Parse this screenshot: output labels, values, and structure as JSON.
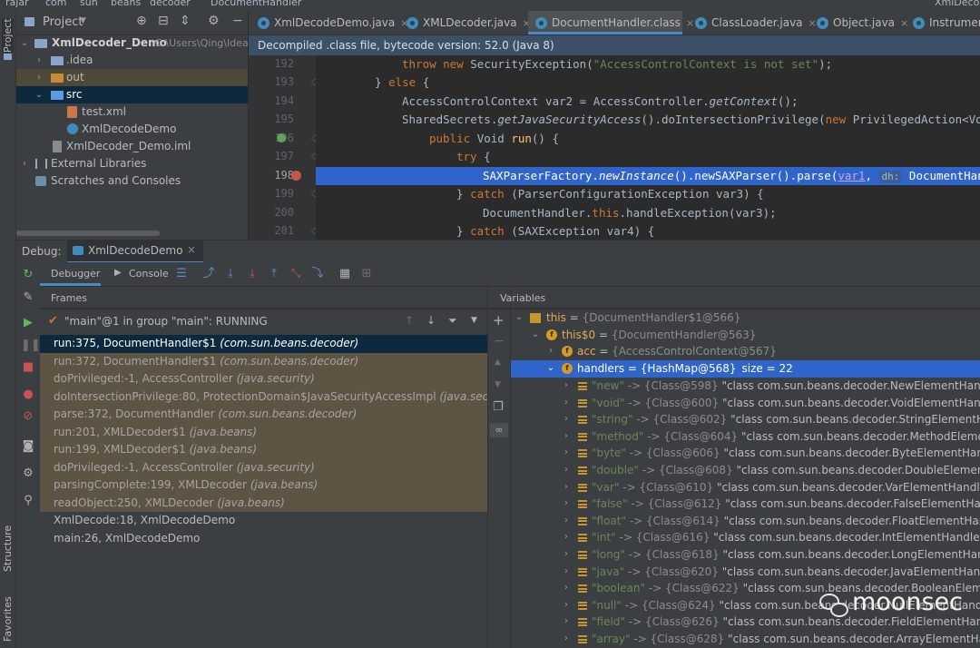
{
  "breadcrumb": {
    "items": [
      "rajar",
      "com",
      "sun",
      "beans",
      "decoder",
      "DocumentHandler"
    ],
    "right": "XmlDecod"
  },
  "left_stripe": {
    "project": "Project",
    "structure": "Structure",
    "favorites": "Favorites"
  },
  "project": {
    "title": "Project",
    "tree": [
      {
        "label": "XmlDecoder_Demo",
        "path": "C:\\Users\\Qing\\Idea",
        "level": 0
      },
      {
        "label": ".idea",
        "level": 1
      },
      {
        "label": "out",
        "level": 1
      },
      {
        "label": "src",
        "level": 1
      },
      {
        "label": "test.xml",
        "level": 2
      },
      {
        "label": "XmlDecodeDemo",
        "level": 2
      },
      {
        "label": "XmlDecoder_Demo.iml",
        "level": 1
      },
      {
        "label": "External Libraries",
        "level": 0
      },
      {
        "label": "Scratches and Consoles",
        "level": 0
      }
    ]
  },
  "editor": {
    "tabs": [
      "XmlDecodeDemo.java",
      "XMLDecoder.java",
      "DocumentHandler.class",
      "ClassLoader.java",
      "Object.java",
      "Instrumen"
    ],
    "active_tab": 2,
    "banner": "Decompiled .class file, bytecode version: 52.0 (Java 8)",
    "line_numbers": [
      "192",
      "193",
      "194",
      "195",
      "196",
      "197",
      "198",
      "199",
      "200",
      "201"
    ],
    "lines": {
      "l192": {
        "kw1": "throw new ",
        "cls": "SecurityException(",
        "str": "\"AccessControlContext is not set\"",
        "end": ");"
      },
      "l193": {
        "brace": "} ",
        "kw": "else",
        "end": " {"
      },
      "l194": {
        "a": "AccessControlContext var2 = AccessController.",
        "m": "getContext",
        "end": "();"
      },
      "l195": {
        "a": "SharedSecrets.",
        "m": "getJavaSecurityAccess",
        "b": "().doIntersectionPrivilege(",
        "kw": "new ",
        "c": "PrivilegedAction<Voi"
      },
      "l196": {
        "kw": "public ",
        "a": "Void ",
        "m": "run",
        "end": "() {"
      },
      "l197": {
        "kw": "try",
        "end": " {"
      },
      "l198": {
        "a": "SAXParserFactory.",
        "m": "newInstance",
        "b": "().newSAXParser().parse(",
        "v": "var1",
        "c": ",",
        "hint": "dh:",
        "d": " DocumentHand"
      },
      "l199": {
        "a": "} ",
        "kw": "catch",
        "b": " (ParserConfigurationException var3) {"
      },
      "l200": {
        "a": "DocumentHandler.",
        "kw": "this",
        "b": ".handleException(var3);"
      },
      "l201": {
        "a": "} ",
        "kw": "catch",
        "b": " (SAXException var4) {"
      }
    }
  },
  "debug": {
    "label": "Debug:",
    "session": "XmlDecodeDemo",
    "tabs": [
      "Debugger",
      "Console"
    ],
    "frames_title": "Frames",
    "variables_title": "Variables",
    "thread": "\"main\"@1 in group \"main\": RUNNING",
    "frames": [
      {
        "text": "run:375, DocumentHandler$1 ",
        "pkg": "(com.sun.beans.decoder)",
        "kind": "sel"
      },
      {
        "text": "run:372, DocumentHandler$1 ",
        "pkg": "(com.sun.beans.decoder)",
        "kind": "lib"
      },
      {
        "text": "doPrivileged:-1, AccessController ",
        "pkg": "(java.security)",
        "kind": "lib"
      },
      {
        "text": "doIntersectionPrivilege:80, ProtectionDomain$JavaSecurityAccessImpl ",
        "pkg": "(java.security)",
        "kind": "lib"
      },
      {
        "text": "parse:372, DocumentHandler ",
        "pkg": "(com.sun.beans.decoder)",
        "kind": "lib"
      },
      {
        "text": "run:201, XMLDecoder$1 ",
        "pkg": "(java.beans)",
        "kind": "lib"
      },
      {
        "text": "run:199, XMLDecoder$1 ",
        "pkg": "(java.beans)",
        "kind": "lib"
      },
      {
        "text": "doPrivileged:-1, AccessController ",
        "pkg": "(java.security)",
        "kind": "lib"
      },
      {
        "text": "parsingComplete:199, XMLDecoder ",
        "pkg": "(java.beans)",
        "kind": "lib"
      },
      {
        "text": "readObject:250, XMLDecoder ",
        "pkg": "(java.beans)",
        "kind": "lib"
      },
      {
        "text": "XmlDecode:18, XmlDecodeDemo",
        "pkg": "",
        "kind": "user"
      },
      {
        "text": "main:26, XmlDecodeDemo",
        "pkg": "",
        "kind": "user"
      }
    ],
    "vars_head": [
      {
        "name": "this",
        "value": "{DocumentHandler$1@566}"
      },
      {
        "name": "this$0",
        "value": "{DocumentHandler@563}"
      },
      {
        "name": "acc",
        "value": "{AccessControlContext@567}"
      },
      {
        "name": "handlers",
        "value": "{HashMap@568}",
        "size": "size = 22"
      }
    ],
    "entries": [
      {
        "k": "\"new\"",
        "ref": "{Class@598}",
        "v": "\"class com.sun.beans.decoder.NewElementHandler\""
      },
      {
        "k": "\"void\"",
        "ref": "{Class@600}",
        "v": "\"class com.sun.beans.decoder.VoidElementHandler\""
      },
      {
        "k": "\"string\"",
        "ref": "{Class@602}",
        "v": "\"class com.sun.beans.decoder.StringElementHandler\""
      },
      {
        "k": "\"method\"",
        "ref": "{Class@604}",
        "v": "\"class com.sun.beans.decoder.MethodElementHandle"
      },
      {
        "k": "\"byte\"",
        "ref": "{Class@606}",
        "v": "\"class com.sun.beans.decoder.ByteElementHandler\""
      },
      {
        "k": "\"double\"",
        "ref": "{Class@608}",
        "v": "\"class com.sun.beans.decoder.DoubleElementHandler"
      },
      {
        "k": "\"var\"",
        "ref": "{Class@610}",
        "v": "\"class com.sun.beans.decoder.VarElementHandler\""
      },
      {
        "k": "\"false\"",
        "ref": "{Class@612}",
        "v": "\"class com.sun.beans.decoder.FalseElementHandler\""
      },
      {
        "k": "\"float\"",
        "ref": "{Class@614}",
        "v": "\"class com.sun.beans.decoder.FloatElementHandler\""
      },
      {
        "k": "\"int\"",
        "ref": "{Class@616}",
        "v": "\"class com.sun.beans.decoder.IntElementHandler\""
      },
      {
        "k": "\"long\"",
        "ref": "{Class@618}",
        "v": "\"class com.sun.beans.decoder.LongElementHandler\""
      },
      {
        "k": "\"java\"",
        "ref": "{Class@620}",
        "v": "\"class com.sun.beans.decoder.JavaElementHandler\""
      },
      {
        "k": "\"boolean\"",
        "ref": "{Class@622}",
        "v": "\"class com.sun.beans.decoder.BooleanElementHandl"
      },
      {
        "k": "\"null\"",
        "ref": "{Class@624}",
        "v": "\"class com.sun.beans.decoder.NullElementHandler\""
      },
      {
        "k": "\"field\"",
        "ref": "{Class@626}",
        "v": "\"class com.sun.beans.decoder.FieldElementHandler\""
      },
      {
        "k": "\"array\"",
        "ref": "{Class@628}",
        "v": "\"class com.sun.beans.decoder.ArrayElementHandler\""
      }
    ]
  },
  "watermark": {
    "text": "moonsec"
  },
  "colors": {
    "selection": "#2f65ca",
    "frame_lib": "#5e5443",
    "frame_selected": "#0d293e",
    "breakpoint": "#c75450",
    "folder": "#8aa5c9",
    "out_folder": "#c88a3b"
  }
}
